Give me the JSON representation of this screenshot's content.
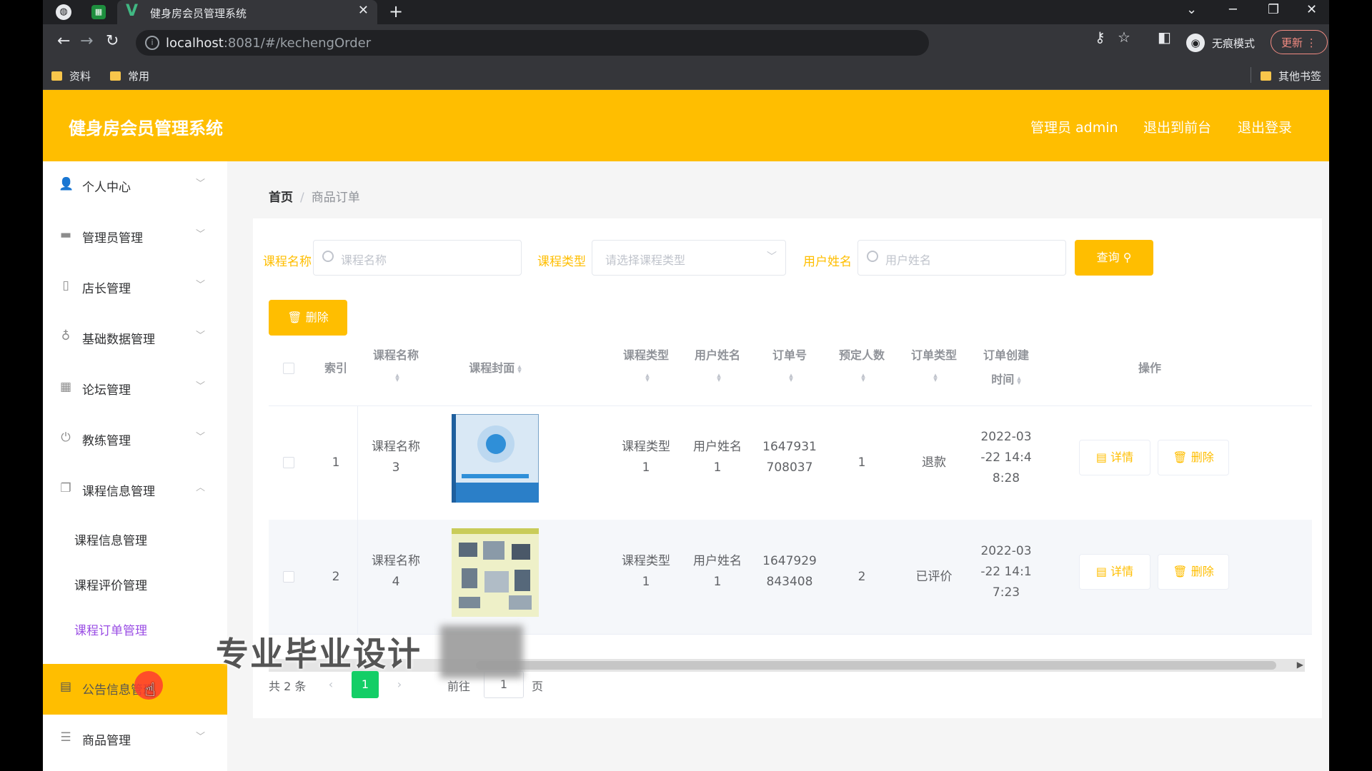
{
  "browser": {
    "tab_title": "健身房会员管理系统",
    "tab_close": "✕",
    "new_tab": "+",
    "url_host": "localhost",
    "url_rest": ":8081/#/kechengOrder",
    "incognito_label": "无痕模式",
    "update_label": "更新",
    "bookmarks": [
      "资料",
      "常用"
    ],
    "other_bookmarks": "其他书签"
  },
  "header": {
    "title": "健身房会员管理系统",
    "user": "管理员 admin",
    "back_to_front": "退出到前台",
    "logout": "退出登录"
  },
  "sidebar": {
    "items": [
      {
        "label": "个人中心",
        "icon": "user-icon"
      },
      {
        "label": "管理员管理",
        "icon": "admin-icon"
      },
      {
        "label": "店长管理",
        "icon": "phone-icon"
      },
      {
        "label": "基础数据管理",
        "icon": "mic-icon"
      },
      {
        "label": "论坛管理",
        "icon": "grid-icon"
      },
      {
        "label": "教练管理",
        "icon": "power-icon"
      },
      {
        "label": "课程信息管理",
        "icon": "copy-icon"
      }
    ],
    "subitems": [
      "课程信息管理",
      "课程评价管理",
      "课程订单管理"
    ],
    "bottom_items": [
      {
        "label": "公告信息管理",
        "icon": "notice-icon"
      },
      {
        "label": "商品管理",
        "icon": "list-icon"
      }
    ]
  },
  "breadcrumb": {
    "home": "首页",
    "sep": "/",
    "current": "商品订单"
  },
  "filters": {
    "course_name_label": "课程名称",
    "course_name_placeholder": "课程名称",
    "course_type_label": "课程类型",
    "course_type_placeholder": "请选择课程类型",
    "user_name_label": "用户姓名",
    "user_name_placeholder": "用户姓名",
    "search_button": "查询"
  },
  "delete_button": "删除",
  "table": {
    "headers": {
      "index": "索引",
      "course_name": "课程名称",
      "cover": "课程封面",
      "course_type": "课程类型",
      "user_name": "用户姓名",
      "order_no": "订单号",
      "reserve_count": "预定人数",
      "order_type": "订单类型",
      "created_l1": "订单创建",
      "created_l2": "时间",
      "actions": "操作"
    },
    "rows": [
      {
        "index": "1",
        "name_l1": "课程名称",
        "name_l2": "3",
        "type_l1": "课程类型",
        "type_l2": "1",
        "user_l1": "用户姓名",
        "user_l2": "1",
        "order_l1": "1647931",
        "order_l2": "708037",
        "count": "1",
        "order_type": "退款",
        "time_l1": "2022-03",
        "time_l2": "-22 14:4",
        "time_l3": "8:28",
        "detail": "详情",
        "delete": "删除"
      },
      {
        "index": "2",
        "name_l1": "课程名称",
        "name_l2": "4",
        "type_l1": "课程类型",
        "type_l2": "1",
        "user_l1": "用户姓名",
        "user_l2": "1",
        "order_l1": "1647929",
        "order_l2": "843408",
        "count": "2",
        "order_type": "已评价",
        "time_l1": "2022-03",
        "time_l2": "-22 14:1",
        "time_l3": "7:23",
        "detail": "详情",
        "delete": "删除"
      }
    ]
  },
  "pagination": {
    "total": "共 2 条",
    "current_page": "1",
    "goto_label": "前往",
    "goto_value": "1",
    "page_suffix": "页"
  },
  "watermark": "专业毕业设计",
  "colors": {
    "accent": "#ffbe00",
    "active_submenu": "#9a4de4",
    "current_page": "#13ce66"
  }
}
